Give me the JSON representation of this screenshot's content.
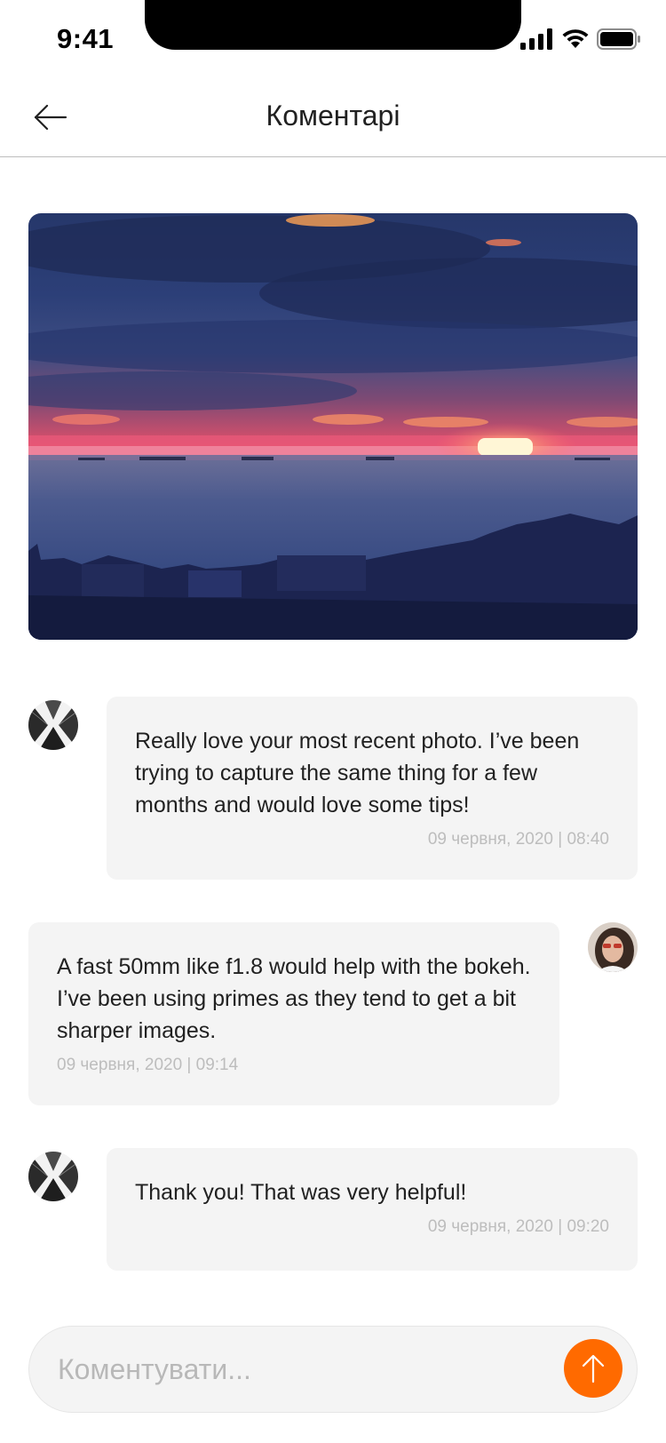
{
  "status_bar": {
    "time": "9:41"
  },
  "header": {
    "title": "Коментарі"
  },
  "comments": [
    {
      "text": "Really love your most recent photo. I’ve been trying to capture the same thing for a few months and would love some tips!",
      "timestamp": "09 червня, 2020 | 08:40",
      "side": "right"
    },
    {
      "text": "A fast 50mm like f1.8 would help with the bokeh. I’ve been using primes as they tend to get a bit sharper images.",
      "timestamp": "09 червня, 2020 | 09:14",
      "side": "left"
    },
    {
      "text": "Thank you! That was very helpful!",
      "timestamp": "09 червня, 2020 | 09:20",
      "side": "right"
    }
  ],
  "comment_input": {
    "placeholder": "Коментувати..."
  },
  "colors": {
    "accent": "#ff6a00",
    "bubble": "#f4f4f4",
    "timestamp": "#bdbdbd"
  }
}
